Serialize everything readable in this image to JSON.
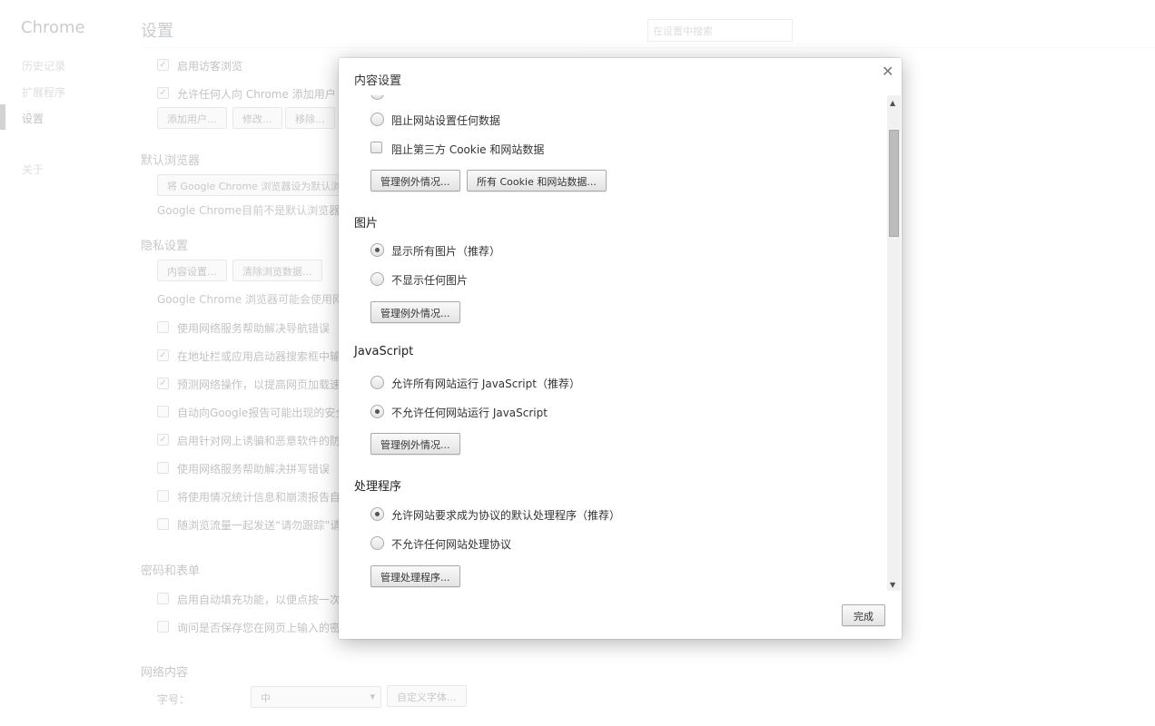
{
  "background": {
    "brand": "Chrome",
    "nav": [
      {
        "label": "历史记录"
      },
      {
        "label": "扩展程序"
      },
      {
        "label": "设置",
        "selected": true
      },
      {
        "label": "关于"
      }
    ],
    "page_title": "设置",
    "search_placeholder": "在设置中搜索",
    "users": {
      "items": [
        {
          "label": "启用访客浏览",
          "checked": true
        },
        {
          "label": "允许任何人向 Chrome 添加用户",
          "checked": true
        }
      ],
      "buttons": [
        "添加用户...",
        "修改...",
        "移除..."
      ]
    },
    "default_browser": {
      "title": "默认浏览器",
      "button": "将 Google Chrome 浏览器设为默认浏",
      "status": "Google Chrome目前不是默认浏览器。"
    },
    "privacy": {
      "title": "隐私设置",
      "buttons": [
        "内容设置...",
        "清除浏览数据..."
      ],
      "desc": "Google Chrome 浏览器可能会使用网络",
      "items": [
        {
          "label": "使用网络服务帮助解决导航错误",
          "checked": false
        },
        {
          "label": "在地址栏或应用启动器搜索框中输",
          "checked": true
        },
        {
          "label": "预测网络操作，以提高网页加载速",
          "checked": true
        },
        {
          "label": "自动向Google报告可能出现的安全",
          "checked": false
        },
        {
          "label": "启用针对网上诱骗和恶意软件的防",
          "checked": true
        },
        {
          "label": "使用网络服务帮助解决拼写错误",
          "checked": false
        },
        {
          "label": "将使用情况统计信息和崩溃报告自",
          "checked": false
        },
        {
          "label": "随浏览流量一起发送“请勿跟踪”请",
          "checked": false
        }
      ]
    },
    "passwords": {
      "title": "密码和表单",
      "items": [
        {
          "label": "启用自动填充功能，以便点按一次",
          "checked": false
        },
        {
          "label": "询问是否保存您在网页上输入的密",
          "checked": false
        }
      ]
    },
    "web_content": {
      "title": "网络内容",
      "font_size_label": "字号：",
      "font_size_value": "中",
      "custom_fonts_button": "自定义字体..."
    }
  },
  "dialog": {
    "title": "内容设置",
    "close_icon": "close-icon",
    "cookies": {
      "block_all": "阻止网站设置任何数据",
      "block_third_party": "阻止第三方 Cookie 和网站数据",
      "manage_exceptions": "管理例外情况...",
      "all_cookies": "所有 Cookie 和网站数据..."
    },
    "images": {
      "title": "图片",
      "options": [
        {
          "label": "显示所有图片（推荐）",
          "selected": true
        },
        {
          "label": "不显示任何图片",
          "selected": false
        }
      ],
      "manage_exceptions": "管理例外情况..."
    },
    "javascript": {
      "title": "JavaScript",
      "options": [
        {
          "label": "允许所有网站运行 JavaScript（推荐）",
          "selected": false
        },
        {
          "label": "不允许任何网站运行 JavaScript",
          "selected": true
        }
      ],
      "manage_exceptions": "管理例外情况..."
    },
    "handlers": {
      "title": "处理程序",
      "options": [
        {
          "label": "允许网站要求成为协议的默认处理程序（推荐）",
          "selected": true
        },
        {
          "label": "不允许任何网站处理协议",
          "selected": false
        }
      ],
      "manage": "管理处理程序..."
    },
    "done": "完成"
  }
}
